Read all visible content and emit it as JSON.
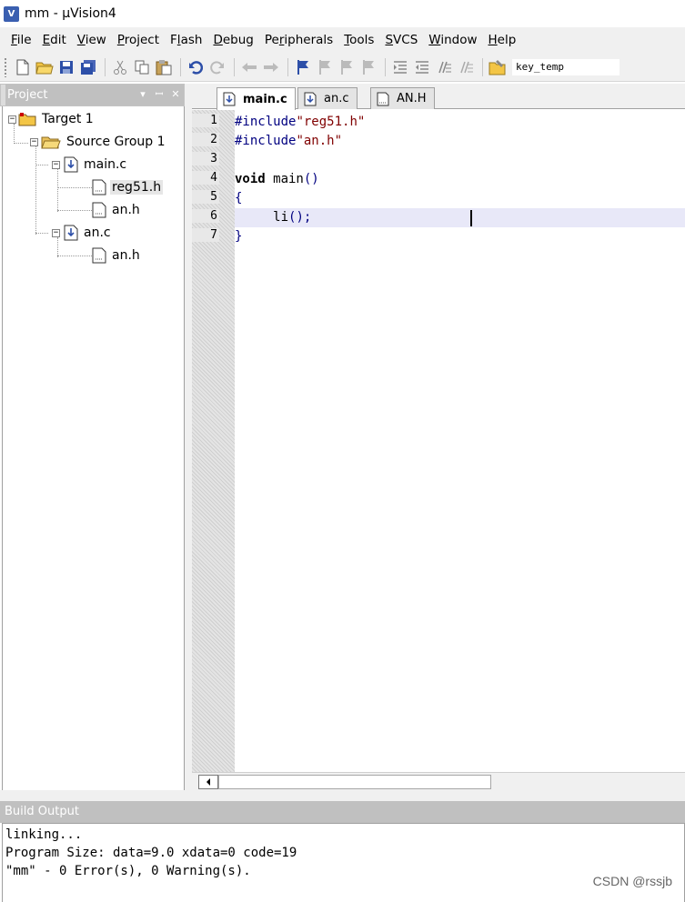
{
  "window": {
    "title": "mm  - µVision4",
    "icon": "uvision-icon"
  },
  "menu": [
    {
      "label": "File",
      "u": "F",
      "rest": "ile"
    },
    {
      "label": "Edit",
      "u": "E",
      "rest": "dit"
    },
    {
      "label": "View",
      "u": "V",
      "rest": "iew"
    },
    {
      "label": "Project",
      "u": "P",
      "rest": "roject"
    },
    {
      "label": "Flash",
      "pre": "F",
      "u": "l",
      "rest": "ash"
    },
    {
      "label": "Debug",
      "u": "D",
      "rest": "ebug"
    },
    {
      "label": "Peripherals",
      "pre": "Pe",
      "u": "r",
      "rest": "ipherals"
    },
    {
      "label": "Tools",
      "u": "T",
      "rest": "ools"
    },
    {
      "label": "SVCS",
      "u": "S",
      "rest": "VCS"
    },
    {
      "label": "Window",
      "u": "W",
      "rest": "indow"
    },
    {
      "label": "Help",
      "u": "H",
      "rest": "elp"
    }
  ],
  "toolbar": {
    "target_combo": "key_temp"
  },
  "project_panel": {
    "title": "Project",
    "controls": [
      "▾",
      "ꟷ",
      "✕"
    ],
    "tree": {
      "target": "Target 1",
      "group": "Source Group 1",
      "main_c": "main.c",
      "reg51_h": "reg51.h",
      "an_h_1": "an.h",
      "an_c": "an.c",
      "an_h_2": "an.h"
    }
  },
  "tabs": [
    {
      "label": "main.c",
      "active": true
    },
    {
      "label": "an.c",
      "active": false
    },
    {
      "label": "AN.H",
      "active": false
    }
  ],
  "editor": {
    "line_numbers": [
      "1",
      "2",
      "3",
      "4",
      "5",
      "6",
      "7"
    ],
    "current_line": 6
  },
  "build_output": {
    "title": "Build Output",
    "lines": [
      "linking...",
      "Program Size: data=9.0 xdata=0 code=19",
      "\"mm\" - 0 Error(s), 0 Warning(s)."
    ]
  },
  "watermark": "CSDN @rssjb"
}
